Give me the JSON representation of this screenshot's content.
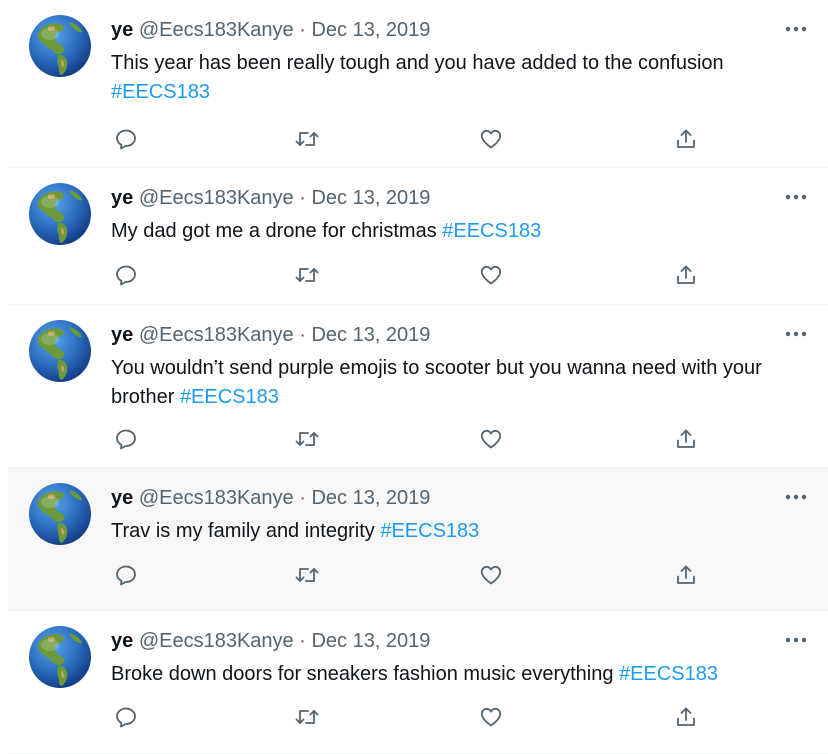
{
  "tweets": [
    {
      "name": "ye",
      "handle": "@Eecs183Kanye",
      "separator": "·",
      "date": "Dec 13, 2019",
      "text": "This year has been really tough and you have added to the confusion ",
      "hashtag": "#EECS183",
      "avatar_icon": "earth-globe-americas-emoji",
      "highlighted": false
    },
    {
      "name": "ye",
      "handle": "@Eecs183Kanye",
      "separator": "·",
      "date": "Dec 13, 2019",
      "text": "My dad got me a drone for christmas ",
      "hashtag": "#EECS183",
      "avatar_icon": "earth-globe-americas-emoji",
      "highlighted": false
    },
    {
      "name": "ye",
      "handle": "@Eecs183Kanye",
      "separator": "·",
      "date": "Dec 13, 2019",
      "text": "You wouldn’t send purple emojis to scooter but you wanna need with your brother ",
      "hashtag": "#EECS183",
      "avatar_icon": "earth-globe-americas-emoji",
      "highlighted": false
    },
    {
      "name": "ye",
      "handle": "@Eecs183Kanye",
      "separator": "·",
      "date": "Dec 13, 2019",
      "text": "Trav is my family and integrity ",
      "hashtag": "#EECS183",
      "avatar_icon": "earth-globe-americas-emoji",
      "highlighted": true
    },
    {
      "name": "ye",
      "handle": "@Eecs183Kanye",
      "separator": "·",
      "date": "Dec 13, 2019",
      "text": "Broke down doors for sneakers fashion music everything ",
      "hashtag": "#EECS183",
      "avatar_icon": "earth-globe-americas-emoji",
      "highlighted": false
    }
  ],
  "icons": {
    "reply": "reply-icon",
    "retweet": "retweet-icon",
    "like": "like-icon",
    "share": "share-icon",
    "more": "more-options-icon"
  },
  "colors": {
    "text": "#0f1419",
    "secondary": "#536471",
    "hashtag": "#1d9bf0",
    "highlight_bg": "#f7f7f7",
    "divider": "#eff3f4"
  }
}
